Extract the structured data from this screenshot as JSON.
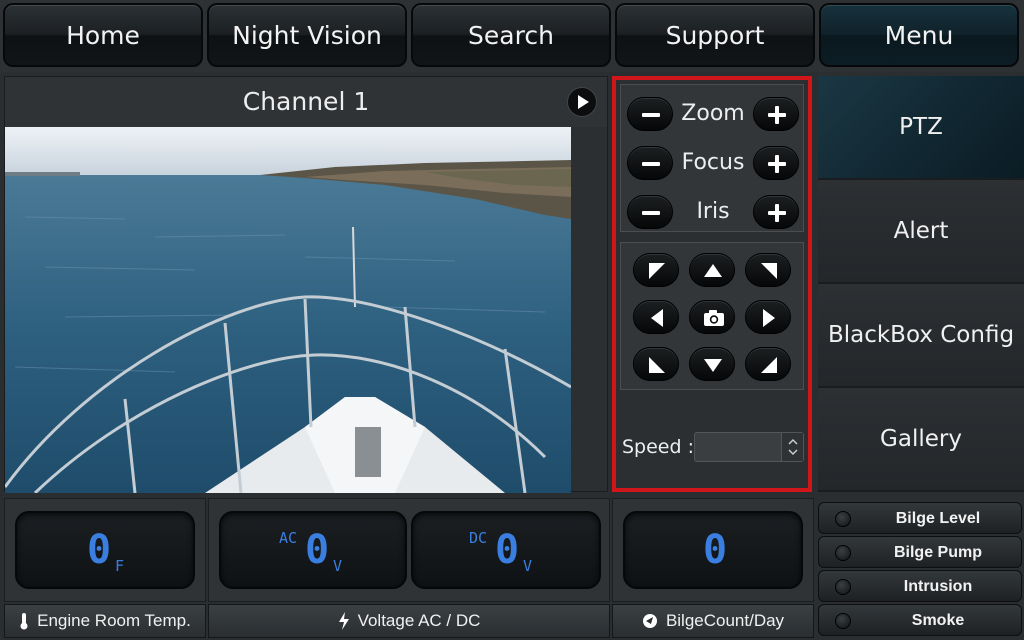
{
  "nav": {
    "home": "Home",
    "night_vision": "Night Vision",
    "search": "Search",
    "support": "Support",
    "menu": "Menu"
  },
  "video": {
    "channel_title": "Channel 1"
  },
  "ptz": {
    "zoom_label": "Zoom",
    "focus_label": "Focus",
    "iris_label": "Iris",
    "speed_label": "Speed :",
    "speed_value": ""
  },
  "side_menu": {
    "items": [
      {
        "label": "PTZ",
        "active": true
      },
      {
        "label": "Alert"
      },
      {
        "label": "BlackBox Config"
      },
      {
        "label": "Gallery"
      }
    ]
  },
  "gauges": {
    "engine_temp": {
      "value": "0",
      "unit": "F",
      "caption": "Engine Room Temp."
    },
    "voltage": {
      "ac": {
        "prefix": "AC",
        "value": "0",
        "unit": "V"
      },
      "dc": {
        "prefix": "DC",
        "value": "0",
        "unit": "V"
      },
      "caption": "Voltage AC / DC"
    },
    "bilge_count": {
      "value": "0",
      "caption": "BilgeCount/Day"
    }
  },
  "status": {
    "bilge_level": "Bilge Level",
    "bilge_pump": "Bilge Pump",
    "intrusion": "Intrusion",
    "smoke": "Smoke"
  },
  "colors": {
    "ptz_highlight": "#d0151b",
    "lcd_digits": "#3a7fe0",
    "active_menu": "#1b3744"
  },
  "icons": {
    "play": "play-icon",
    "camera": "camera-icon",
    "thermometer": "thermometer-icon",
    "lightning": "lightning-icon",
    "gauge": "gauge-icon"
  }
}
